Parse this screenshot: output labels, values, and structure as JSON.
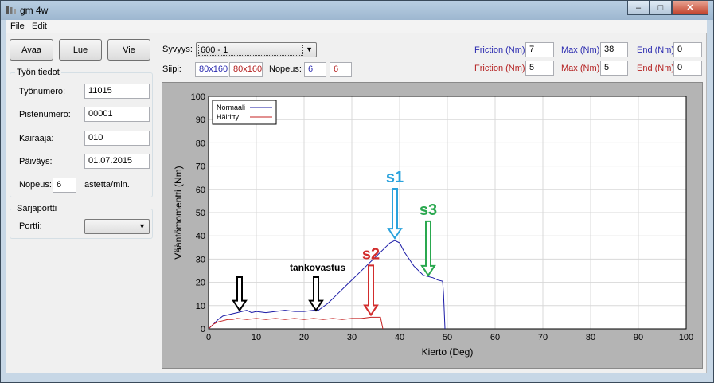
{
  "window": {
    "title": "gm 4w"
  },
  "menu": [
    "File",
    "Edit"
  ],
  "toolbar": {
    "open_label": "Avaa",
    "read_label": "Lue",
    "export_label": "Vie"
  },
  "depth": {
    "label": "Syvyys:",
    "value": "600 - 1"
  },
  "tip": {
    "label": "Siipi:",
    "blue_value": "80x160",
    "red_value": "80x160"
  },
  "speed_top": {
    "label": "Nopeus:",
    "blue_value": "6",
    "red_value": "6"
  },
  "limits": {
    "friction_label": "Friction (Nm)",
    "max_label": "Max (Nm)",
    "end_label": "End (Nm)",
    "row1": {
      "friction": "7",
      "max": "38",
      "end": "0"
    },
    "row2": {
      "friction": "5",
      "max": "5",
      "end": "0"
    },
    "row1_color": "#2b2bb0",
    "row2_color": "#b52222"
  },
  "work_info": {
    "title": "Työn tiedot",
    "job_number_label": "Työnumero:",
    "job_number": "11015",
    "point_number_label": "Pistenumero:",
    "point_number": "00001",
    "drill_label": "Kairaaja:",
    "drill": "010",
    "date_label": "Päiväys:",
    "date": "01.07.2015",
    "speed_label": "Nopeus:",
    "speed": "6",
    "speed_unit": "astetta/min."
  },
  "serial": {
    "title": "Sarjaportti",
    "port_label": "Portti:",
    "port_value": ""
  },
  "chart_data": {
    "type": "line",
    "xlabel": "Kierto (Deg)",
    "ylabel": "Vääntömomentti (Nm)",
    "xlim": [
      0,
      100
    ],
    "ylim": [
      0,
      100
    ],
    "xticks": [
      0,
      10,
      20,
      30,
      40,
      50,
      60,
      70,
      80,
      90,
      100
    ],
    "yticks": [
      0,
      10,
      20,
      30,
      40,
      50,
      60,
      70,
      80,
      90,
      100
    ],
    "grid": true,
    "legend_position": "top-left",
    "series": [
      {
        "name": "Normaali",
        "color": "#1a1aa6",
        "x": [
          0,
          1,
          2,
          3,
          4,
          5,
          6,
          7,
          8,
          9,
          10,
          12,
          14,
          16,
          18,
          20,
          22,
          23,
          25,
          27,
          29,
          31,
          33,
          35,
          37,
          38,
          39,
          40,
          41,
          43,
          45,
          47,
          48,
          49,
          49.2,
          49.5
        ],
        "y": [
          0,
          2,
          4,
          5.5,
          6,
          6.5,
          7,
          7.5,
          8,
          7,
          7.5,
          7,
          7.5,
          8,
          7.5,
          7.5,
          8,
          8,
          11,
          15,
          19,
          23,
          27,
          31,
          35,
          37,
          38,
          37,
          33,
          27,
          23,
          22,
          21,
          20.5,
          15,
          0
        ]
      },
      {
        "name": "Häiritty",
        "color": "#c42020",
        "x": [
          0,
          1,
          2,
          3,
          4,
          5,
          6,
          8,
          10,
          12,
          14,
          16,
          18,
          20,
          22,
          24,
          26,
          28,
          30,
          32,
          34,
          35,
          36,
          36.5
        ],
        "y": [
          0,
          2,
          3,
          3.5,
          4,
          4,
          4.5,
          4,
          4.5,
          4,
          4.5,
          4,
          4.5,
          4,
          4.5,
          4,
          4.5,
          4,
          4.5,
          4.5,
          5,
          5,
          5,
          0
        ]
      }
    ],
    "annotations": [
      {
        "text": "s1",
        "x": 39,
        "y_text": 63,
        "y_tip": 39,
        "color": "#2aa2dc"
      },
      {
        "text": "s2",
        "x": 34,
        "y_text": 30,
        "y_tip": 6,
        "color": "#d22d2d"
      },
      {
        "text": "s3",
        "x": 46,
        "y_text": 49,
        "y_tip": 23,
        "color": "#2aa84f"
      },
      {
        "text": "tankovastus",
        "x": 17,
        "y_text": 25,
        "color": "#000000",
        "arrows_x": [
          6.5,
          22.5
        ],
        "arrow_tip_y": 8
      }
    ]
  }
}
